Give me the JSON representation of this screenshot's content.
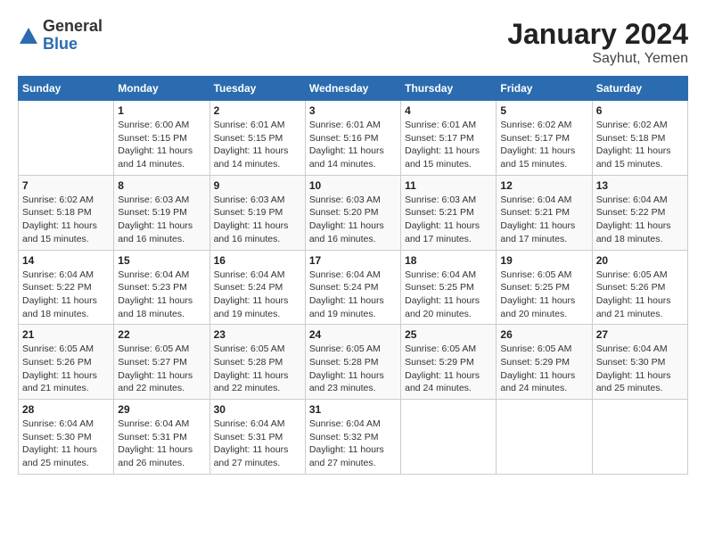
{
  "header": {
    "logo_general": "General",
    "logo_blue": "Blue",
    "month_year": "January 2024",
    "location": "Sayhut, Yemen"
  },
  "weekdays": [
    "Sunday",
    "Monday",
    "Tuesday",
    "Wednesday",
    "Thursday",
    "Friday",
    "Saturday"
  ],
  "weeks": [
    [
      {
        "day": "",
        "sunrise": "",
        "sunset": "",
        "daylight": ""
      },
      {
        "day": "1",
        "sunrise": "Sunrise: 6:00 AM",
        "sunset": "Sunset: 5:15 PM",
        "daylight": "Daylight: 11 hours and 14 minutes."
      },
      {
        "day": "2",
        "sunrise": "Sunrise: 6:01 AM",
        "sunset": "Sunset: 5:15 PM",
        "daylight": "Daylight: 11 hours and 14 minutes."
      },
      {
        "day": "3",
        "sunrise": "Sunrise: 6:01 AM",
        "sunset": "Sunset: 5:16 PM",
        "daylight": "Daylight: 11 hours and 14 minutes."
      },
      {
        "day": "4",
        "sunrise": "Sunrise: 6:01 AM",
        "sunset": "Sunset: 5:17 PM",
        "daylight": "Daylight: 11 hours and 15 minutes."
      },
      {
        "day": "5",
        "sunrise": "Sunrise: 6:02 AM",
        "sunset": "Sunset: 5:17 PM",
        "daylight": "Daylight: 11 hours and 15 minutes."
      },
      {
        "day": "6",
        "sunrise": "Sunrise: 6:02 AM",
        "sunset": "Sunset: 5:18 PM",
        "daylight": "Daylight: 11 hours and 15 minutes."
      }
    ],
    [
      {
        "day": "7",
        "sunrise": "Sunrise: 6:02 AM",
        "sunset": "Sunset: 5:18 PM",
        "daylight": "Daylight: 11 hours and 15 minutes."
      },
      {
        "day": "8",
        "sunrise": "Sunrise: 6:03 AM",
        "sunset": "Sunset: 5:19 PM",
        "daylight": "Daylight: 11 hours and 16 minutes."
      },
      {
        "day": "9",
        "sunrise": "Sunrise: 6:03 AM",
        "sunset": "Sunset: 5:19 PM",
        "daylight": "Daylight: 11 hours and 16 minutes."
      },
      {
        "day": "10",
        "sunrise": "Sunrise: 6:03 AM",
        "sunset": "Sunset: 5:20 PM",
        "daylight": "Daylight: 11 hours and 16 minutes."
      },
      {
        "day": "11",
        "sunrise": "Sunrise: 6:03 AM",
        "sunset": "Sunset: 5:21 PM",
        "daylight": "Daylight: 11 hours and 17 minutes."
      },
      {
        "day": "12",
        "sunrise": "Sunrise: 6:04 AM",
        "sunset": "Sunset: 5:21 PM",
        "daylight": "Daylight: 11 hours and 17 minutes."
      },
      {
        "day": "13",
        "sunrise": "Sunrise: 6:04 AM",
        "sunset": "Sunset: 5:22 PM",
        "daylight": "Daylight: 11 hours and 18 minutes."
      }
    ],
    [
      {
        "day": "14",
        "sunrise": "Sunrise: 6:04 AM",
        "sunset": "Sunset: 5:22 PM",
        "daylight": "Daylight: 11 hours and 18 minutes."
      },
      {
        "day": "15",
        "sunrise": "Sunrise: 6:04 AM",
        "sunset": "Sunset: 5:23 PM",
        "daylight": "Daylight: 11 hours and 18 minutes."
      },
      {
        "day": "16",
        "sunrise": "Sunrise: 6:04 AM",
        "sunset": "Sunset: 5:24 PM",
        "daylight": "Daylight: 11 hours and 19 minutes."
      },
      {
        "day": "17",
        "sunrise": "Sunrise: 6:04 AM",
        "sunset": "Sunset: 5:24 PM",
        "daylight": "Daylight: 11 hours and 19 minutes."
      },
      {
        "day": "18",
        "sunrise": "Sunrise: 6:04 AM",
        "sunset": "Sunset: 5:25 PM",
        "daylight": "Daylight: 11 hours and 20 minutes."
      },
      {
        "day": "19",
        "sunrise": "Sunrise: 6:05 AM",
        "sunset": "Sunset: 5:25 PM",
        "daylight": "Daylight: 11 hours and 20 minutes."
      },
      {
        "day": "20",
        "sunrise": "Sunrise: 6:05 AM",
        "sunset": "Sunset: 5:26 PM",
        "daylight": "Daylight: 11 hours and 21 minutes."
      }
    ],
    [
      {
        "day": "21",
        "sunrise": "Sunrise: 6:05 AM",
        "sunset": "Sunset: 5:26 PM",
        "daylight": "Daylight: 11 hours and 21 minutes."
      },
      {
        "day": "22",
        "sunrise": "Sunrise: 6:05 AM",
        "sunset": "Sunset: 5:27 PM",
        "daylight": "Daylight: 11 hours and 22 minutes."
      },
      {
        "day": "23",
        "sunrise": "Sunrise: 6:05 AM",
        "sunset": "Sunset: 5:28 PM",
        "daylight": "Daylight: 11 hours and 22 minutes."
      },
      {
        "day": "24",
        "sunrise": "Sunrise: 6:05 AM",
        "sunset": "Sunset: 5:28 PM",
        "daylight": "Daylight: 11 hours and 23 minutes."
      },
      {
        "day": "25",
        "sunrise": "Sunrise: 6:05 AM",
        "sunset": "Sunset: 5:29 PM",
        "daylight": "Daylight: 11 hours and 24 minutes."
      },
      {
        "day": "26",
        "sunrise": "Sunrise: 6:05 AM",
        "sunset": "Sunset: 5:29 PM",
        "daylight": "Daylight: 11 hours and 24 minutes."
      },
      {
        "day": "27",
        "sunrise": "Sunrise: 6:04 AM",
        "sunset": "Sunset: 5:30 PM",
        "daylight": "Daylight: 11 hours and 25 minutes."
      }
    ],
    [
      {
        "day": "28",
        "sunrise": "Sunrise: 6:04 AM",
        "sunset": "Sunset: 5:30 PM",
        "daylight": "Daylight: 11 hours and 25 minutes."
      },
      {
        "day": "29",
        "sunrise": "Sunrise: 6:04 AM",
        "sunset": "Sunset: 5:31 PM",
        "daylight": "Daylight: 11 hours and 26 minutes."
      },
      {
        "day": "30",
        "sunrise": "Sunrise: 6:04 AM",
        "sunset": "Sunset: 5:31 PM",
        "daylight": "Daylight: 11 hours and 27 minutes."
      },
      {
        "day": "31",
        "sunrise": "Sunrise: 6:04 AM",
        "sunset": "Sunset: 5:32 PM",
        "daylight": "Daylight: 11 hours and 27 minutes."
      },
      {
        "day": "",
        "sunrise": "",
        "sunset": "",
        "daylight": ""
      },
      {
        "day": "",
        "sunrise": "",
        "sunset": "",
        "daylight": ""
      },
      {
        "day": "",
        "sunrise": "",
        "sunset": "",
        "daylight": ""
      }
    ]
  ]
}
